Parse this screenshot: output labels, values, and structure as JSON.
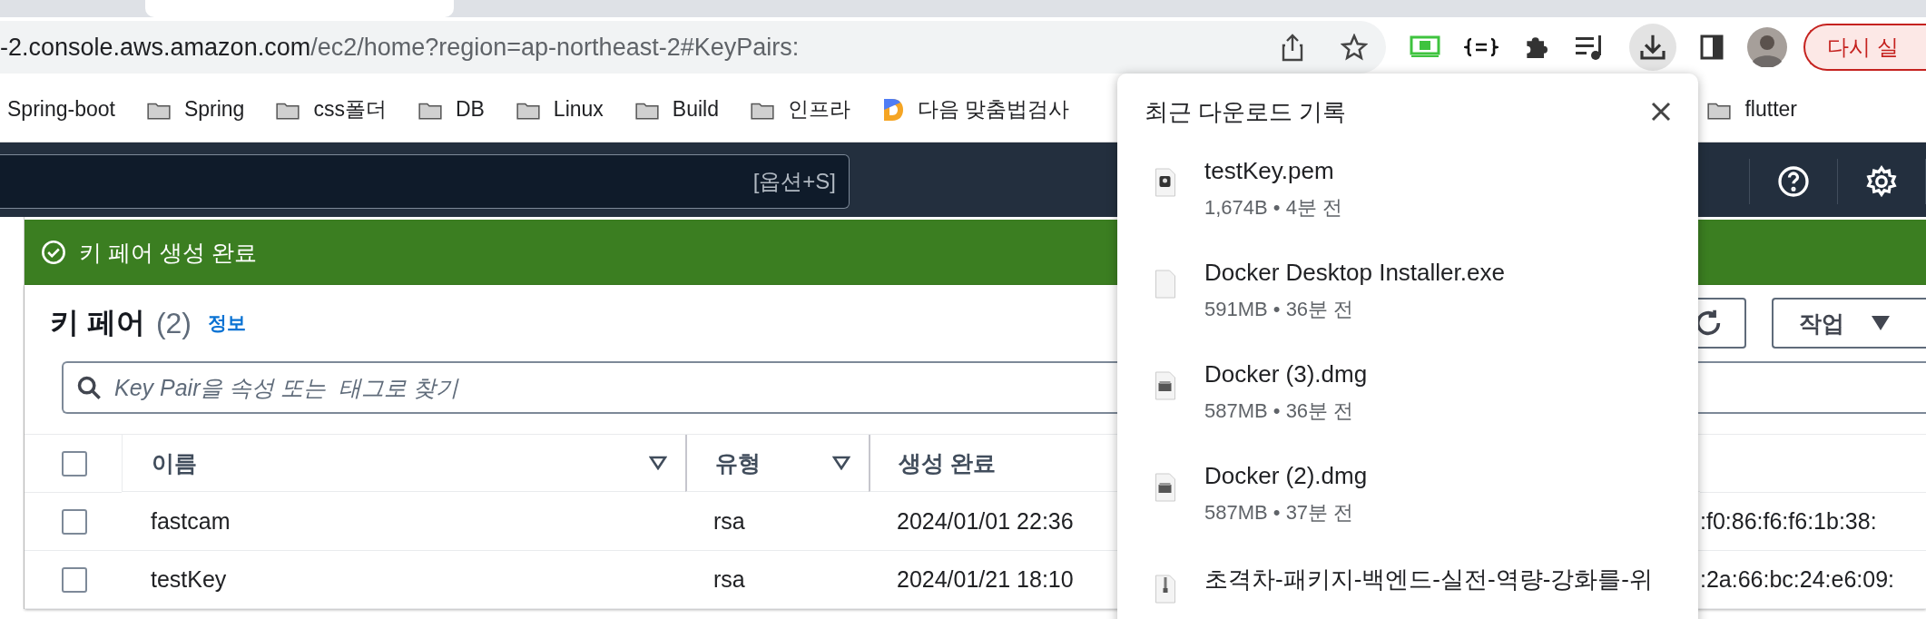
{
  "address_bar": {
    "host": "-2.console.aws.amazon.com",
    "path": "/ec2/home?region=ap-northeast-2#KeyPairs:"
  },
  "toolbar": {
    "relaunch_button": "다시 실",
    "downloads_active": true
  },
  "bookmarks": [
    {
      "label": "Spring-boot",
      "kind": "plain"
    },
    {
      "label": "Spring",
      "kind": "folder"
    },
    {
      "label": "css폴더",
      "kind": "folder"
    },
    {
      "label": "DB",
      "kind": "folder"
    },
    {
      "label": "Linux",
      "kind": "folder"
    },
    {
      "label": "Build",
      "kind": "folder"
    },
    {
      "label": "인프라",
      "kind": "folder"
    },
    {
      "label": "다음 맞춤법검사",
      "kind": "site"
    },
    {
      "label": "flutter",
      "kind": "folder"
    }
  ],
  "console_header": {
    "search_shortcut": "[옵션+S]"
  },
  "flash": {
    "message": "키 페어 생성 완료"
  },
  "key_pairs": {
    "title": "키 페어",
    "count": "(2)",
    "info_link": "정보",
    "actions_button": "작업",
    "search": {
      "placeholder": "Key Pair을 속성 또는  태그로 찾기"
    },
    "table": {
      "select_all_checked": false,
      "columns": [
        "이름",
        "유형",
        "생성 완료"
      ],
      "rows": [
        {
          "checked": false,
          "name": "fastcam",
          "type": "rsa",
          "created": "2024/01/01 22:36",
          "fingerprint": ":f0:86:f6:f6:1b:38:"
        },
        {
          "checked": false,
          "name": "testKey",
          "type": "rsa",
          "created": "2024/01/21 18:10",
          "fingerprint": ":2a:66:bc:24:e6:09:"
        }
      ]
    }
  },
  "downloads_popup": {
    "title": "최근 다운로드 기록",
    "items": [
      {
        "kind": "certificate",
        "name": "testKey.pem",
        "meta": "1,674B • 4분 전"
      },
      {
        "kind": "blank",
        "name": "Docker Desktop Installer.exe",
        "meta": "591MB • 36분 전"
      },
      {
        "kind": "disk",
        "name": "Docker (3).dmg",
        "meta": "587MB • 36분 전"
      },
      {
        "kind": "disk",
        "name": "Docker (2).dmg",
        "meta": "587MB • 37분 전"
      },
      {
        "kind": "zip",
        "name": "초격차-패키지-백엔드-실전-역량-강화를-위"
      }
    ]
  }
}
